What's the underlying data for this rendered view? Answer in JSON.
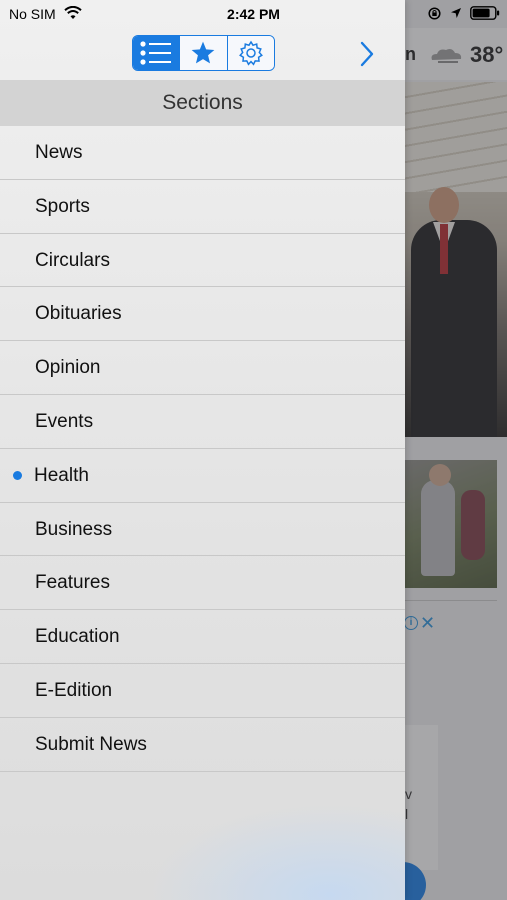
{
  "status_bar": {
    "carrier": "No SIM",
    "time": "2:42 PM"
  },
  "background": {
    "weather_partial": "n",
    "temperature": "38°",
    "card_text_1": "v",
    "card_text_2": "l",
    "ad_close": "✕"
  },
  "drawer": {
    "toolbar": {
      "tabs": [
        {
          "icon": "list-icon",
          "active": true
        },
        {
          "icon": "star-icon",
          "active": false
        },
        {
          "icon": "gear-icon",
          "active": false
        }
      ],
      "forward_icon": "chevron-right-icon"
    },
    "header": "Sections",
    "items": [
      {
        "label": "News"
      },
      {
        "label": "Sports"
      },
      {
        "label": "Circulars"
      },
      {
        "label": "Obituaries"
      },
      {
        "label": "Opinion"
      },
      {
        "label": "Events"
      },
      {
        "label": "Health",
        "selected": true
      },
      {
        "label": "Business"
      },
      {
        "label": "Features"
      },
      {
        "label": "Education"
      },
      {
        "label": "E-Edition"
      },
      {
        "label": "Submit News"
      }
    ]
  },
  "colors": {
    "accent": "#1a7be0",
    "header_bg": "#d3d3d3",
    "divider": "#c8c8c8"
  }
}
